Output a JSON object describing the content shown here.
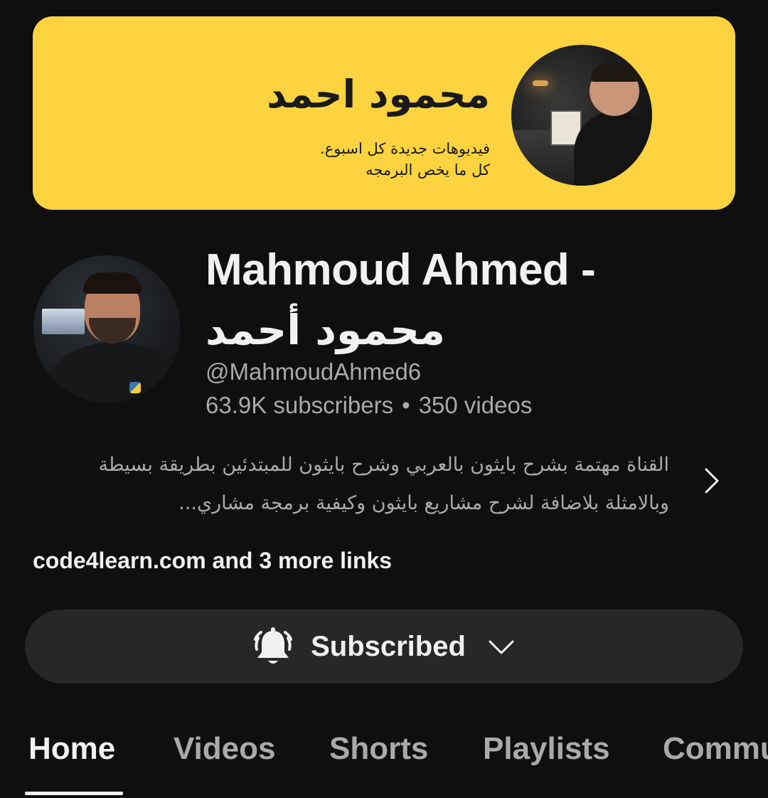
{
  "banner": {
    "title": "محمود احمد",
    "line1": "فيديوهات جديدة  كل اسبوع.",
    "line2": "كل ما يخص البرمجه"
  },
  "channel": {
    "name_en": "Mahmoud Ahmed -",
    "name_ar": "محمود أحمد",
    "handle": "@MahmoudAhmed6",
    "subscribers": "63.9K subscribers",
    "separator": "•",
    "videos": "350 videos",
    "description": "القناة مهتمة بشرح بايثون بالعربي وشرح بايثون للمبتدئين بطريقة بسيطة وبالامثلة بلاضافة لشرح مشاريع بايثون وكيفية برمجة مشاري...",
    "links": "code4learn.com and 3 more links"
  },
  "subscribe": {
    "label": "Subscribed",
    "icon": "bell-ringing-icon",
    "dropdown_icon": "chevron-down-icon"
  },
  "tabs": [
    {
      "label": "Home",
      "active": true
    },
    {
      "label": "Videos",
      "active": false
    },
    {
      "label": "Shorts",
      "active": false
    },
    {
      "label": "Playlists",
      "active": false
    },
    {
      "label": "Community",
      "active": false
    }
  ],
  "colors": {
    "background": "#0f0f0f",
    "banner": "#fdd33f",
    "button": "#272727",
    "text_primary": "#f1f1f1",
    "text_secondary": "#aaaaaa"
  }
}
